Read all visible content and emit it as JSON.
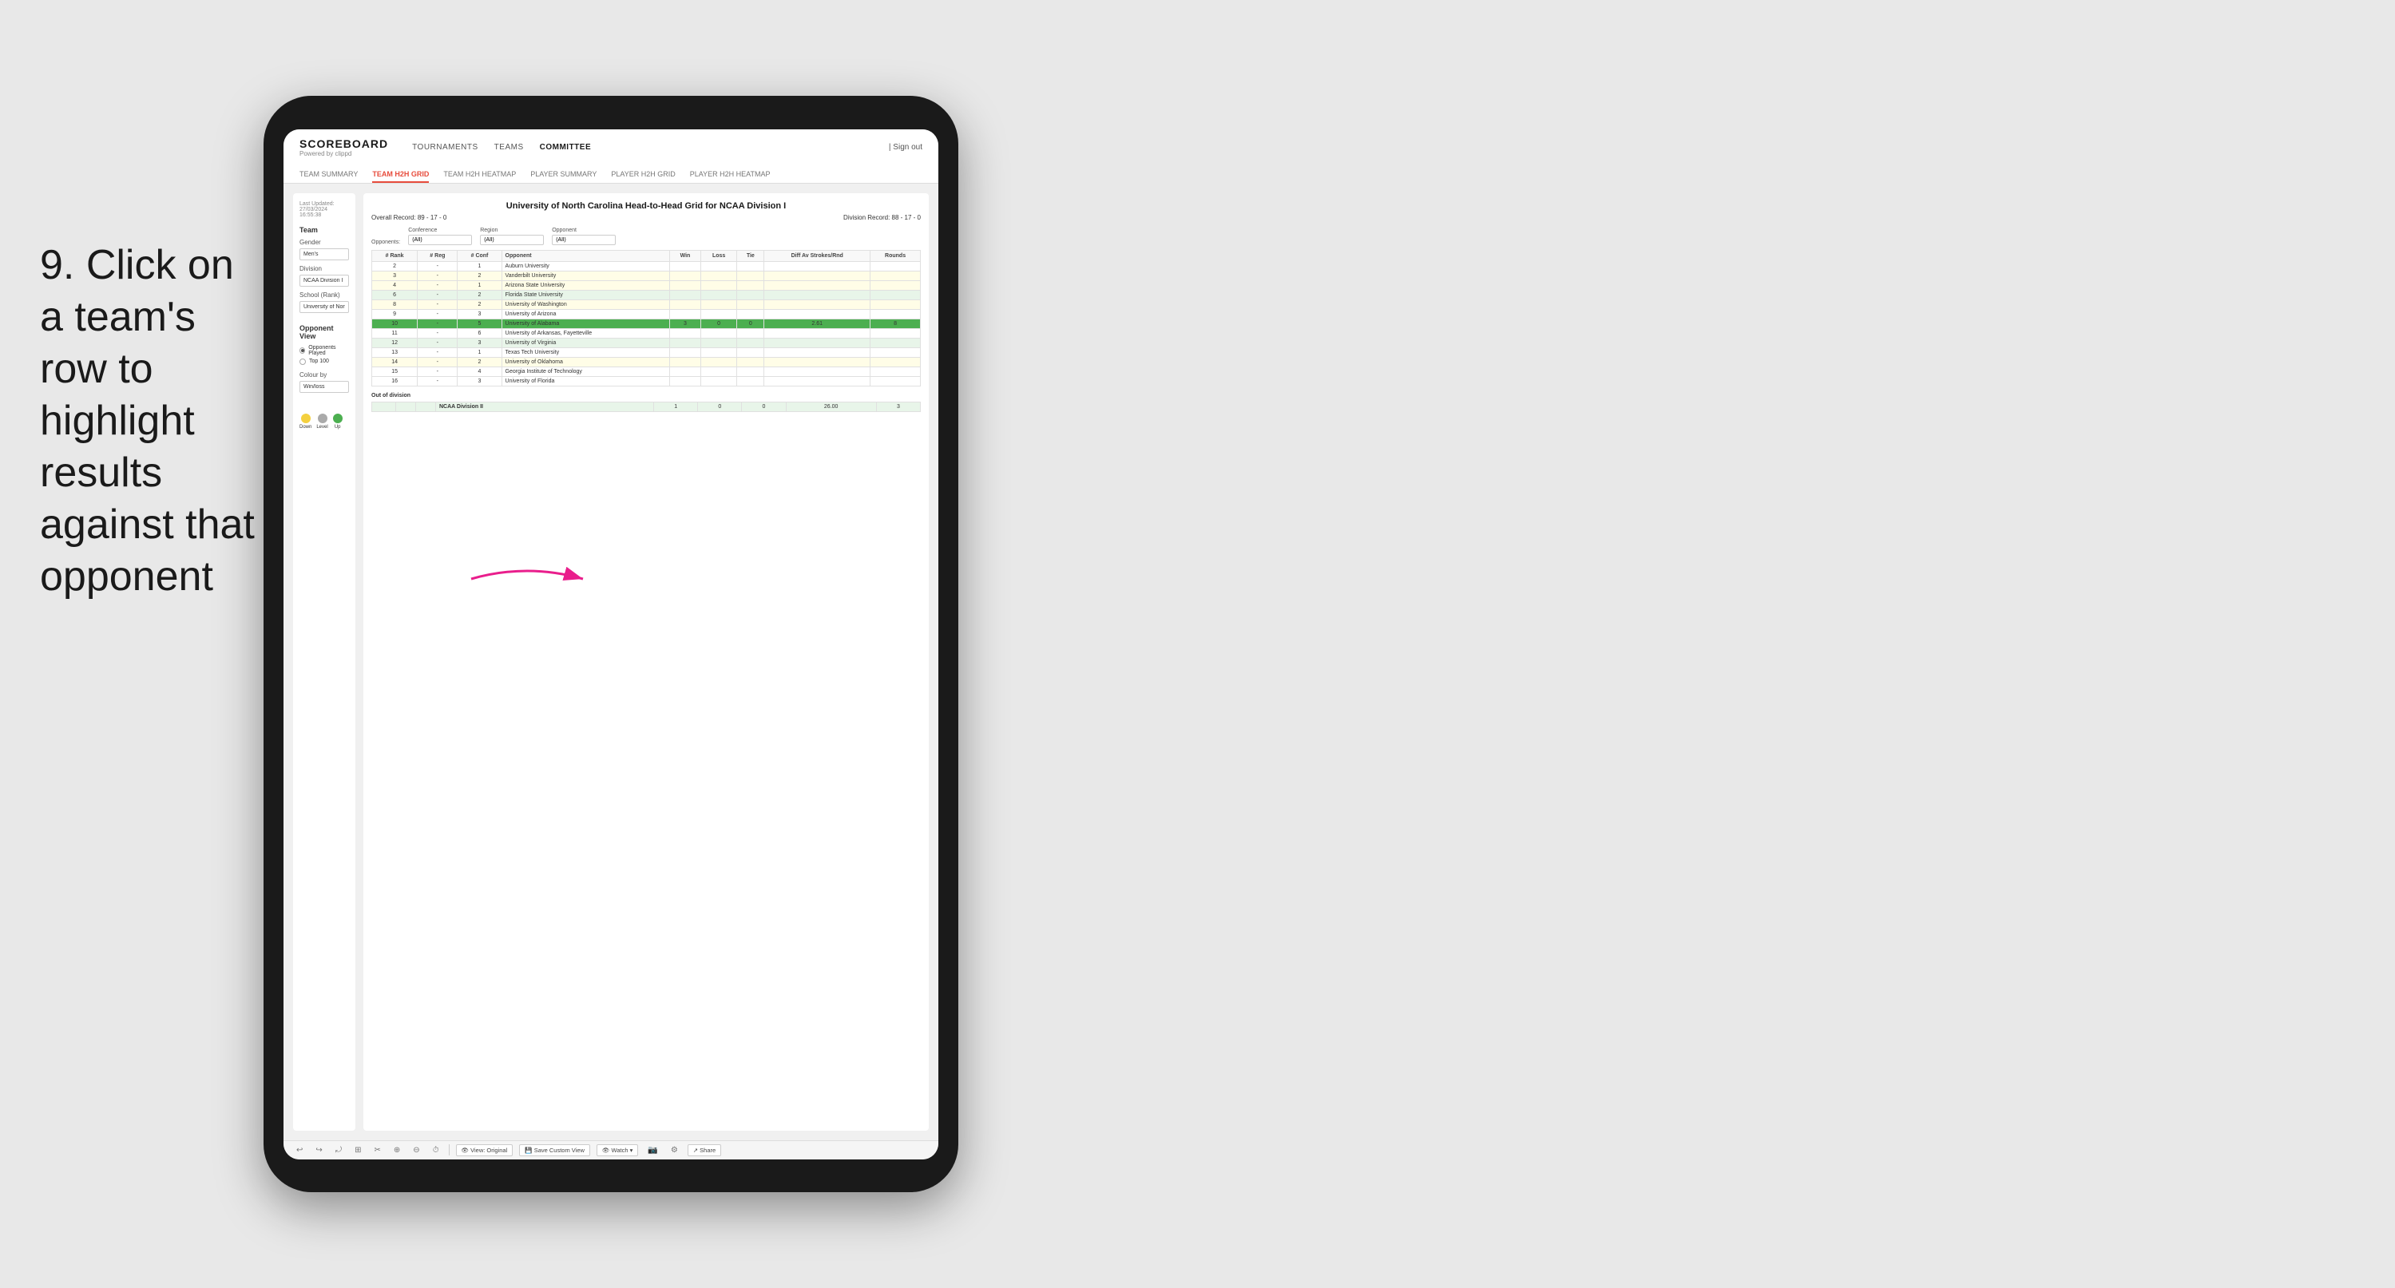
{
  "instruction": {
    "step": "9.",
    "text": "Click on a team's row to highlight results against that opponent"
  },
  "nav": {
    "logo": "SCOREBOARD",
    "logo_sub": "Powered by clippd",
    "links": [
      "TOURNAMENTS",
      "TEAMS",
      "COMMITTEE"
    ],
    "active_link": "COMMITTEE",
    "sign_out": "Sign out",
    "sub_tabs": [
      "TEAM SUMMARY",
      "TEAM H2H GRID",
      "TEAM H2H HEATMAP",
      "PLAYER SUMMARY",
      "PLAYER H2H GRID",
      "PLAYER H2H HEATMAP"
    ],
    "active_sub_tab": "TEAM H2H GRID"
  },
  "sidebar": {
    "timestamp_label": "Last Updated: 27/03/2024",
    "timestamp_time": "16:55:38",
    "team_label": "Team",
    "gender_label": "Gender",
    "gender_value": "Men's",
    "division_label": "Division",
    "division_value": "NCAA Division I",
    "school_label": "School (Rank)",
    "school_value": "University of Nort...",
    "opponent_view_label": "Opponent View",
    "opponent_view_options": [
      "Opponents Played",
      "Top 100"
    ],
    "opponent_view_selected": "Opponents Played",
    "colour_by_label": "Colour by",
    "colour_by_value": "Win/loss",
    "legend": [
      {
        "label": "Down",
        "color": "#f4d03f"
      },
      {
        "label": "Level",
        "color": "#aaaaaa"
      },
      {
        "label": "Up",
        "color": "#4caf50"
      }
    ]
  },
  "panel": {
    "title": "University of North Carolina Head-to-Head Grid for NCAA Division I",
    "overall_record_label": "Overall Record:",
    "overall_record": "89 - 17 - 0",
    "division_record_label": "Division Record:",
    "division_record": "88 - 17 - 0",
    "filters": {
      "conference_label": "Conference",
      "conference_value": "(All)",
      "region_label": "Region",
      "region_value": "(All)",
      "opponent_label": "Opponent",
      "opponent_value": "(All)",
      "opponents_label": "Opponents:"
    },
    "table": {
      "headers": [
        "# Rank",
        "# Reg",
        "# Conf",
        "Opponent",
        "Win",
        "Loss",
        "Tie",
        "Diff Av Strokes/Rnd",
        "Rounds"
      ],
      "rows": [
        {
          "rank": "2",
          "reg": "-",
          "conf": "1",
          "opponent": "Auburn University",
          "win": "",
          "loss": "",
          "tie": "",
          "diff": "",
          "rounds": "",
          "style": "normal"
        },
        {
          "rank": "3",
          "reg": "-",
          "conf": "2",
          "opponent": "Vanderbilt University",
          "win": "",
          "loss": "",
          "tie": "",
          "diff": "",
          "rounds": "",
          "style": "light-yellow"
        },
        {
          "rank": "4",
          "reg": "-",
          "conf": "1",
          "opponent": "Arizona State University",
          "win": "",
          "loss": "",
          "tie": "",
          "diff": "",
          "rounds": "",
          "style": "light-yellow"
        },
        {
          "rank": "6",
          "reg": "-",
          "conf": "2",
          "opponent": "Florida State University",
          "win": "",
          "loss": "",
          "tie": "",
          "diff": "",
          "rounds": "",
          "style": "light-green"
        },
        {
          "rank": "8",
          "reg": "-",
          "conf": "2",
          "opponent": "University of Washington",
          "win": "",
          "loss": "",
          "tie": "",
          "diff": "",
          "rounds": "",
          "style": "light-yellow"
        },
        {
          "rank": "9",
          "reg": "-",
          "conf": "3",
          "opponent": "University of Arizona",
          "win": "",
          "loss": "",
          "tie": "",
          "diff": "",
          "rounds": "",
          "style": "normal"
        },
        {
          "rank": "10",
          "reg": "-",
          "conf": "5",
          "opponent": "University of Alabama",
          "win": "3",
          "loss": "0",
          "tie": "0",
          "diff": "2.61",
          "rounds": "8",
          "style": "highlight"
        },
        {
          "rank": "11",
          "reg": "-",
          "conf": "6",
          "opponent": "University of Arkansas, Fayetteville",
          "win": "",
          "loss": "",
          "tie": "",
          "diff": "",
          "rounds": "",
          "style": "normal"
        },
        {
          "rank": "12",
          "reg": "-",
          "conf": "3",
          "opponent": "University of Virginia",
          "win": "",
          "loss": "",
          "tie": "",
          "diff": "",
          "rounds": "",
          "style": "light-green"
        },
        {
          "rank": "13",
          "reg": "-",
          "conf": "1",
          "opponent": "Texas Tech University",
          "win": "",
          "loss": "",
          "tie": "",
          "diff": "",
          "rounds": "",
          "style": "normal"
        },
        {
          "rank": "14",
          "reg": "-",
          "conf": "2",
          "opponent": "University of Oklahoma",
          "win": "",
          "loss": "",
          "tie": "",
          "diff": "",
          "rounds": "",
          "style": "light-yellow"
        },
        {
          "rank": "15",
          "reg": "-",
          "conf": "4",
          "opponent": "Georgia Institute of Technology",
          "win": "",
          "loss": "",
          "tie": "",
          "diff": "",
          "rounds": "",
          "style": "normal"
        },
        {
          "rank": "16",
          "reg": "-",
          "conf": "3",
          "opponent": "University of Florida",
          "win": "",
          "loss": "",
          "tie": "",
          "diff": "",
          "rounds": "",
          "style": "normal"
        }
      ]
    },
    "out_of_division_label": "Out of division",
    "ncaa_row": {
      "label": "NCAA Division II",
      "win": "1",
      "loss": "0",
      "tie": "0",
      "diff": "26.00",
      "rounds": "3"
    }
  },
  "toolbar": {
    "buttons": [
      "↩",
      "↪",
      "⤾",
      "⊞",
      "✂",
      "⊕",
      "⊖",
      "⌚"
    ],
    "view_label": "View: Original",
    "save_label": "Save Custom View",
    "watch_label": "Watch ▾",
    "share_label": "Share"
  }
}
